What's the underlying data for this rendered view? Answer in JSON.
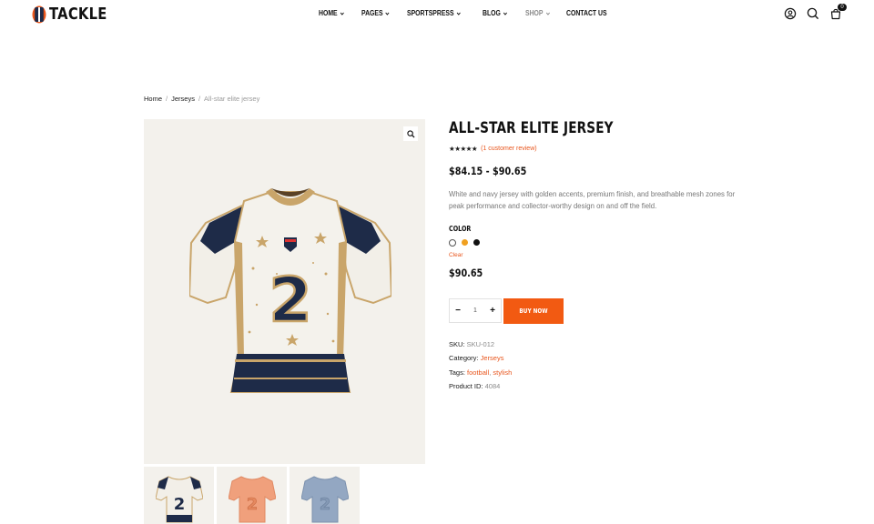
{
  "brand": {
    "name": "TACKLE",
    "accent": "#f25a12",
    "navy": "#1e2b48"
  },
  "nav": {
    "items": [
      {
        "label": "Home",
        "dropdown": true,
        "muted": false
      },
      {
        "label": "Pages",
        "dropdown": true,
        "muted": false
      },
      {
        "label": "SportsPress",
        "dropdown": true,
        "muted": false
      },
      {
        "label": "Blog",
        "dropdown": true,
        "muted": false
      },
      {
        "label": "Shop",
        "dropdown": true,
        "muted": true
      },
      {
        "label": "Contact Us",
        "dropdown": false,
        "muted": false
      }
    ]
  },
  "header_icons": {
    "account": "user-circle-icon",
    "search": "search-icon",
    "cart": "shopping-bag-icon",
    "cart_count": "0"
  },
  "breadcrumb": {
    "home": "Home",
    "category": "Jerseys",
    "current": "All-star elite jersey",
    "separator": "/"
  },
  "gallery": {
    "zoom_icon": "magnifier-icon",
    "thumbnail_count": 3,
    "thumbnail_colors": [
      "white-navy",
      "orange",
      "blue-grey"
    ]
  },
  "product": {
    "title": "All-Star Elite Jersey",
    "rating": 5,
    "stars": "★★★★★",
    "review_text": "(1 customer review)",
    "price_range": "$84.15 - $90.65",
    "description": "White and navy jersey with golden accents, premium finish, and breathable mesh zones for peak performance and collector-worthy design on and off the field.",
    "color_label": "Color",
    "swatches": [
      {
        "name": "white",
        "hex": "#ffffff",
        "selected": true
      },
      {
        "name": "orange",
        "hex": "#f0a020",
        "selected": false
      },
      {
        "name": "black",
        "hex": "#111111",
        "selected": false
      }
    ],
    "clear_label": "Clear",
    "selected_price": "$90.65",
    "quantity": "1",
    "minus": "−",
    "plus": "+",
    "buy_label": "Buy Now",
    "jersey_number": "2"
  },
  "meta": {
    "sku_label": "SKU:",
    "sku": "SKU-012",
    "category_label": "Category:",
    "category": "Jerseys",
    "tags_label": "Tags:",
    "tags": [
      "football",
      "stylish"
    ],
    "tag_sep": ",",
    "id_label": "Product ID:",
    "id": "4084"
  }
}
